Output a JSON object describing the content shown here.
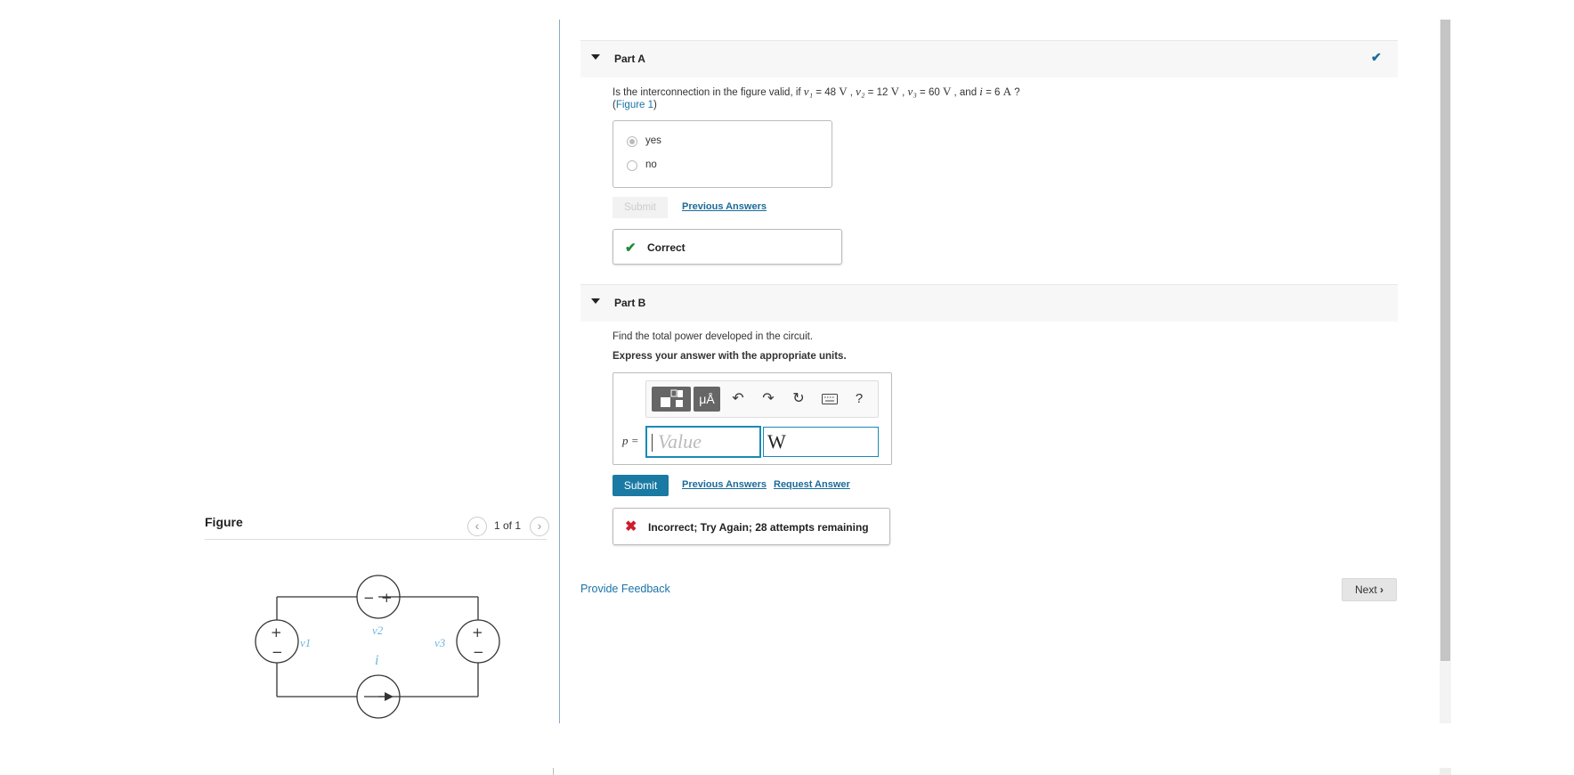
{
  "figure": {
    "title": "Figure",
    "page_indicator": "1 of 1",
    "circuit": {
      "labels": {
        "v1": "v1",
        "v2": "v2",
        "v3": "v3",
        "i": "i"
      },
      "signs": {
        "plus": "+",
        "minus": "−"
      }
    }
  },
  "part_a": {
    "label": "Part A",
    "question": {
      "prefix": "Is the interconnection in the figure valid, if ",
      "v1_sym": "v₁",
      "v1_val": " = 48 ",
      "v_unit": "V",
      "v2_sym": "v₂",
      "v2_val": " = 12 ",
      "v3_sym": "v₃",
      "v3_val": " = 60 ",
      "and": " , and ",
      "i_sym": "i",
      "i_val": " = 6 ",
      "i_unit": "A",
      "suffix": " ?",
      "comma": " , ",
      "figure_link": "Figure 1",
      "paren_open": "(",
      "paren_close": ")"
    },
    "choices": [
      {
        "label": "yes",
        "selected": true
      },
      {
        "label": "no",
        "selected": false
      }
    ],
    "submit_label": "Submit",
    "previous_answers_label": "Previous Answers",
    "feedback": "Correct"
  },
  "part_b": {
    "label": "Part B",
    "question": "Find the total power developed in the circuit.",
    "instruction": "Express your answer with the appropriate units.",
    "variable_label": "p =",
    "value_placeholder": "Value",
    "unit_value": "W",
    "toolbar": {
      "templates_icon": "templates-icon",
      "units_label": "μÅ",
      "undo_icon": "undo-icon",
      "redo_icon": "redo-icon",
      "reset_icon": "reset-icon",
      "keyboard_icon": "keyboard-icon",
      "help_label": "?"
    },
    "submit_label": "Submit",
    "previous_answers_label": "Previous Answers",
    "request_answer_label": "Request Answer",
    "feedback": "Incorrect; Try Again; 28 attempts remaining"
  },
  "footer": {
    "provide_feedback_label": "Provide Feedback",
    "next_label": "Next"
  },
  "colors": {
    "accent": "#1a7aa3",
    "correct": "#1f8a3a",
    "incorrect": "#cc1f2b",
    "circuit_label": "#6bb6e0"
  }
}
